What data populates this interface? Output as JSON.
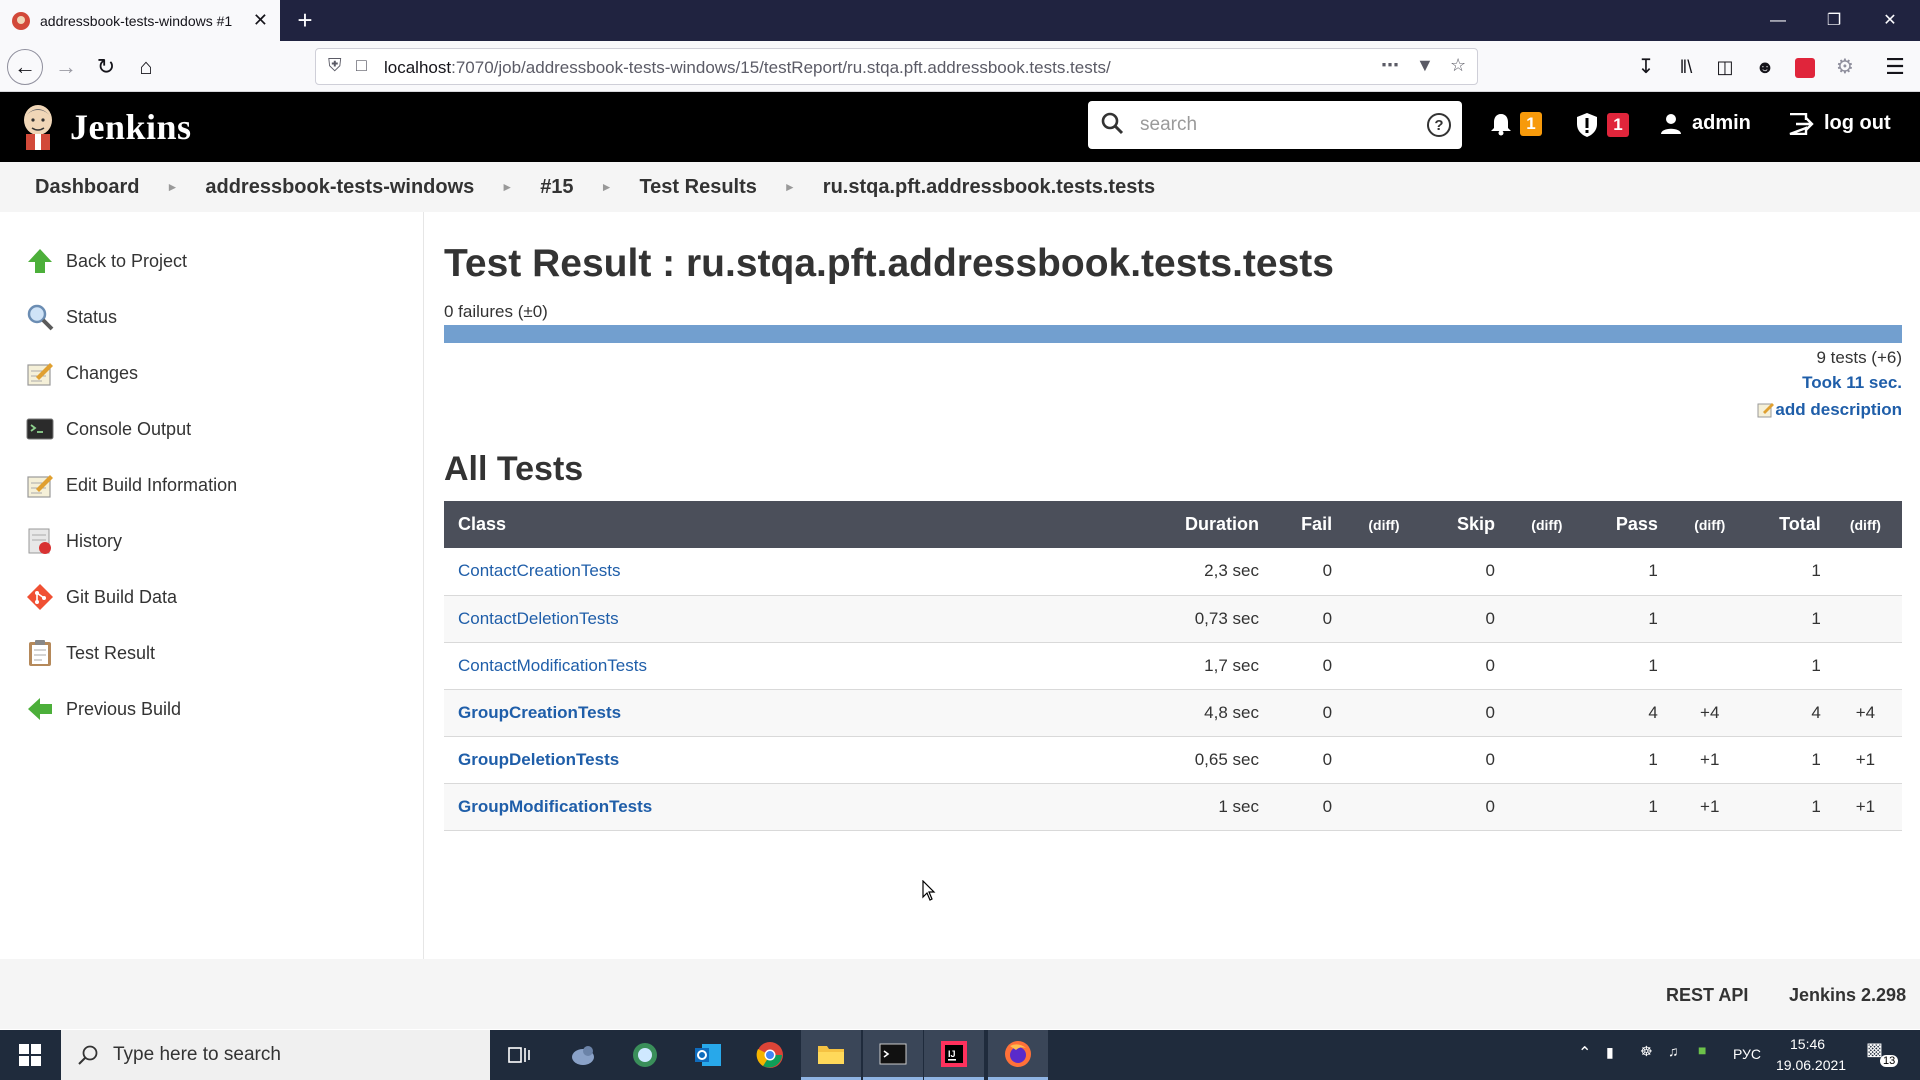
{
  "browser": {
    "tab_title": "addressbook-tests-windows #1",
    "url_host": "localhost",
    "url_rest": ":7070/job/addressbook-tests-windows/15/testReport/ru.stqa.pft.addressbook.tests.tests/"
  },
  "header": {
    "brand": "Jenkins",
    "search_placeholder": "search",
    "notifications_count": "1",
    "security_count": "1",
    "user": "admin",
    "logout": "log out"
  },
  "breadcrumb": [
    "Dashboard",
    "addressbook-tests-windows",
    "#15",
    "Test Results",
    "ru.stqa.pft.addressbook.tests.tests"
  ],
  "sidebar": [
    {
      "label": "Back to Project",
      "icon": "up-arrow-icon"
    },
    {
      "label": "Status",
      "icon": "magnifier-icon"
    },
    {
      "label": "Changes",
      "icon": "notepad-icon"
    },
    {
      "label": "Console Output",
      "icon": "terminal-icon"
    },
    {
      "label": "Edit Build Information",
      "icon": "notepad-icon"
    },
    {
      "label": "History",
      "icon": "history-icon"
    },
    {
      "label": "Git Build Data",
      "icon": "git-icon"
    },
    {
      "label": "Test Result",
      "icon": "clipboard-icon"
    },
    {
      "label": "Previous Build",
      "icon": "left-arrow-icon"
    }
  ],
  "main": {
    "title": "Test Result : ru.stqa.pft.addressbook.tests.tests",
    "failures": "0 failures (±0)",
    "pass_fraction": 1.0,
    "tests_count": "9 tests (+6)",
    "took": "Took 11 sec.",
    "add_description": "add description",
    "section_title": "All Tests",
    "columns": [
      "Class",
      "Duration",
      "Fail",
      "(diff)",
      "Skip",
      "(diff)",
      "Pass",
      "(diff)",
      "Total",
      "(diff)"
    ],
    "rows": [
      {
        "cls": "ContactCreationTests",
        "duration": "2,3 sec",
        "fail": "0",
        "fail_diff": "",
        "skip": "0",
        "skip_diff": "",
        "pass": "1",
        "pass_diff": "",
        "total": "1",
        "total_diff": ""
      },
      {
        "cls": "ContactDeletionTests",
        "duration": "0,73 sec",
        "fail": "0",
        "fail_diff": "",
        "skip": "0",
        "skip_diff": "",
        "pass": "1",
        "pass_diff": "",
        "total": "1",
        "total_diff": ""
      },
      {
        "cls": "ContactModificationTests",
        "duration": "1,7 sec",
        "fail": "0",
        "fail_diff": "",
        "skip": "0",
        "skip_diff": "",
        "pass": "1",
        "pass_diff": "",
        "total": "1",
        "total_diff": ""
      },
      {
        "cls": "GroupCreationTests",
        "duration": "4,8 sec",
        "fail": "0",
        "fail_diff": "",
        "skip": "0",
        "skip_diff": "",
        "pass": "4",
        "pass_diff": "+4",
        "total": "4",
        "total_diff": "+4"
      },
      {
        "cls": "GroupDeletionTests",
        "duration": "0,65 sec",
        "fail": "0",
        "fail_diff": "",
        "skip": "0",
        "skip_diff": "",
        "pass": "1",
        "pass_diff": "+1",
        "total": "1",
        "total_diff": "+1"
      },
      {
        "cls": "GroupModificationTests",
        "duration": "1 sec",
        "fail": "0",
        "fail_diff": "",
        "skip": "0",
        "skip_diff": "",
        "pass": "1",
        "pass_diff": "+1",
        "total": "1",
        "total_diff": "+1"
      }
    ]
  },
  "footer": {
    "rest_api": "REST API",
    "version": "Jenkins 2.298"
  },
  "taskbar": {
    "search_placeholder": "Type here to search",
    "lang": "РУС",
    "time": "15:46",
    "date": "19.06.2021",
    "notifications": "13"
  }
}
